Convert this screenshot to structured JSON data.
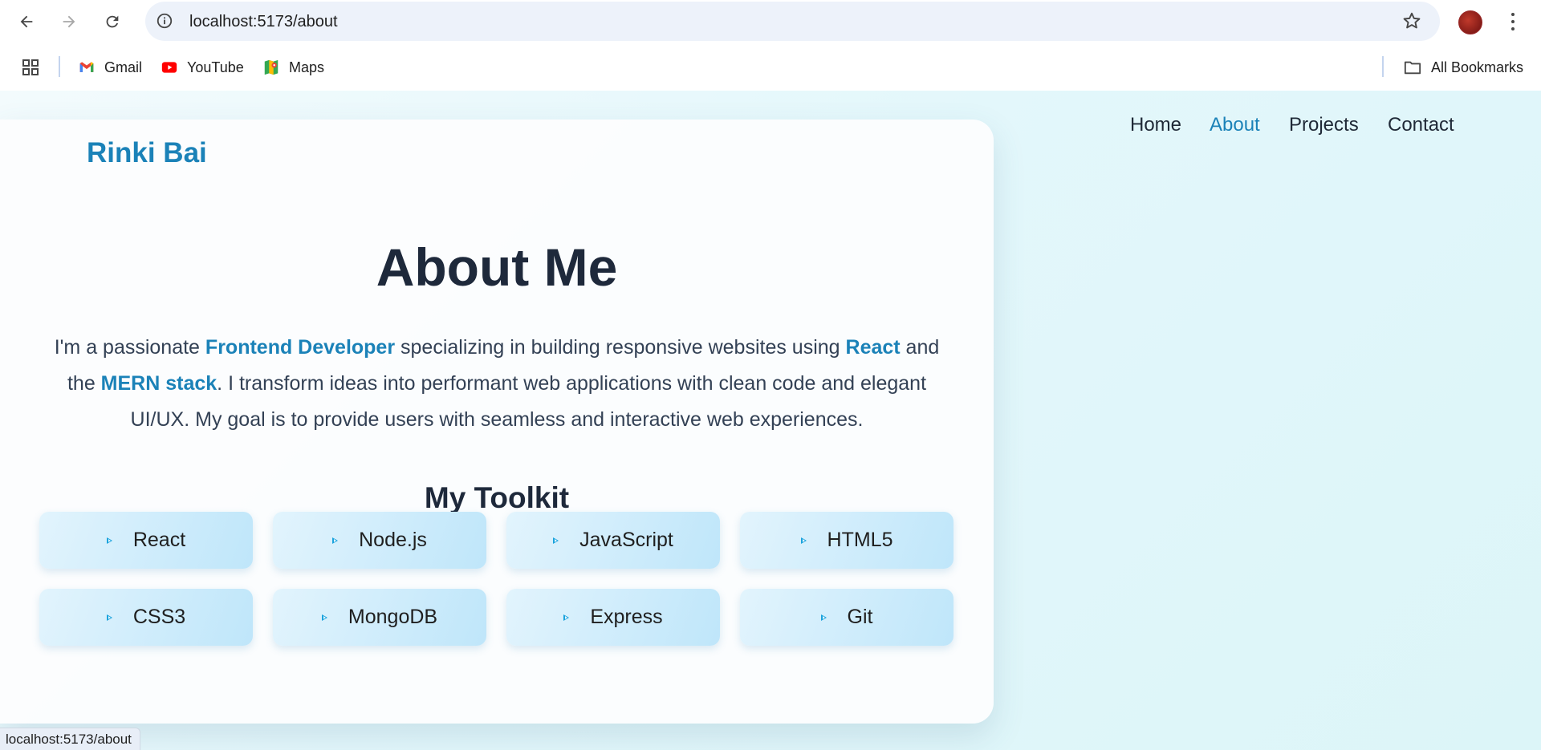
{
  "browser": {
    "url": "localhost:5173/about",
    "bookmarks": [
      {
        "label": "Gmail"
      },
      {
        "label": "YouTube"
      },
      {
        "label": "Maps"
      }
    ],
    "all_bookmarks": "All Bookmarks",
    "status_url": "localhost:5173/about"
  },
  "site": {
    "brand": "Rinki Bai",
    "nav": [
      {
        "label": "Home",
        "active": false
      },
      {
        "label": "About",
        "active": true
      },
      {
        "label": "Projects",
        "active": false
      },
      {
        "label": "Contact",
        "active": false
      }
    ]
  },
  "about": {
    "title": "About Me",
    "intro": [
      {
        "text": "I'm a passionate ",
        "bold": false
      },
      {
        "text": "Frontend Developer",
        "bold": true
      },
      {
        "text": " specializing in building responsive websites using ",
        "bold": false
      },
      {
        "text": "React",
        "bold": true
      },
      {
        "text": " and the ",
        "bold": false
      },
      {
        "text": "MERN stack",
        "bold": true
      },
      {
        "text": ". I transform ideas into performant web applications with clean code and elegant UI/UX. My goal is to provide users with seamless and interactive web experiences.",
        "bold": false
      }
    ],
    "toolkit_title": "My Toolkit",
    "toolkit": [
      "React",
      "Node.js",
      "JavaScript",
      "HTML5",
      "CSS3",
      "MongoDB",
      "Express",
      "Git"
    ]
  },
  "colors": {
    "accent": "#1b82b8",
    "heading": "#1e293b",
    "chip_icon": "#1aa3dd"
  },
  "icons": {
    "back": "arrow-left-icon",
    "forward": "arrow-right-icon",
    "reload": "reload-icon",
    "site_info": "info-icon",
    "bookmark_star": "star-icon",
    "apps": "apps-grid-icon",
    "folder": "folder-icon",
    "chip": "triangle-play-icon"
  }
}
